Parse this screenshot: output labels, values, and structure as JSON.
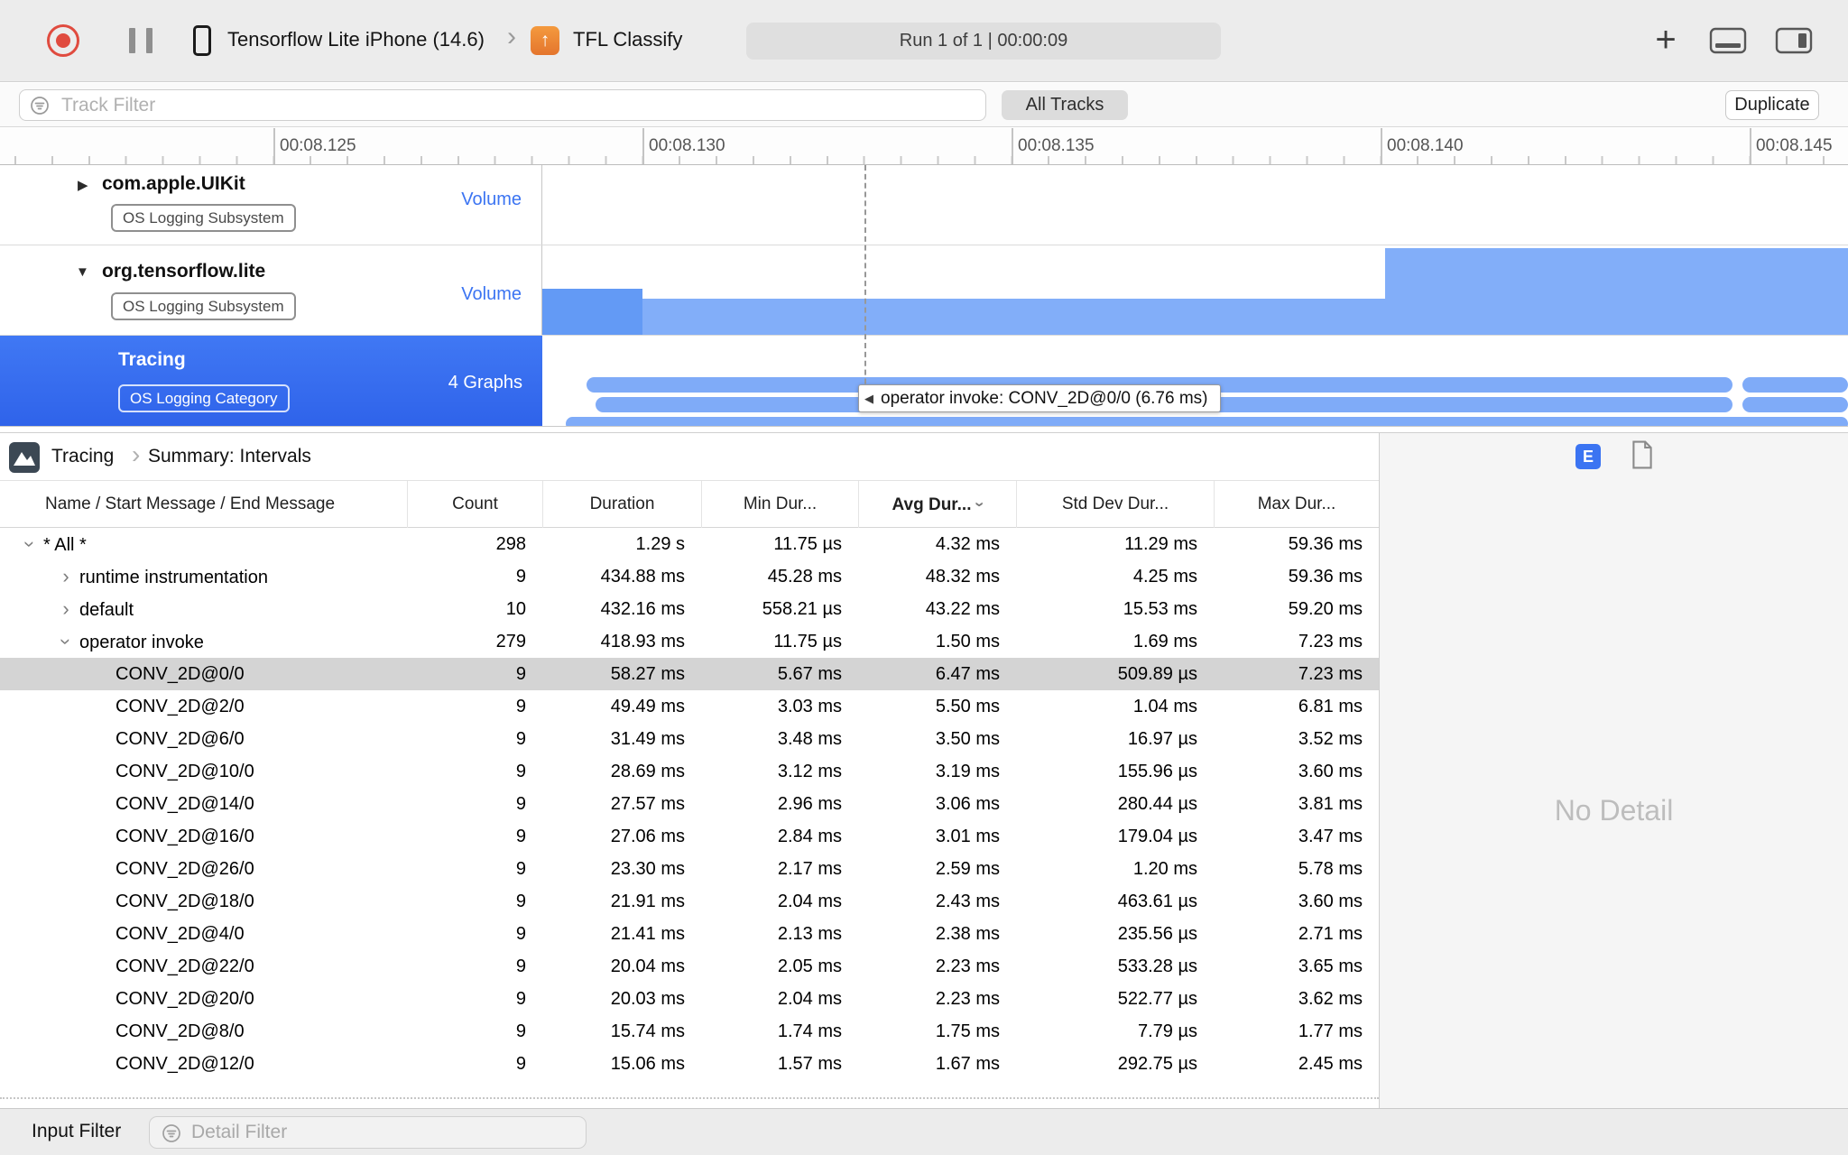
{
  "toolbar": {
    "device_name": "Tensorflow Lite iPhone (14.6)",
    "app_name": "TFL Classify",
    "run_status": "Run 1 of 1  |  00:00:09"
  },
  "filter_bar": {
    "track_filter_placeholder": "Track Filter",
    "all_tracks": "All Tracks",
    "duplicate": "Duplicate"
  },
  "ruler": {
    "labels": [
      "00:08.125",
      "00:08.130",
      "00:08.135",
      "00:08.140",
      "00:08.145"
    ]
  },
  "tracks": [
    {
      "name": "com.apple.UIKit",
      "badge": "OS Logging Subsystem",
      "meta": "Volume",
      "disclosure": "closed",
      "selected": false
    },
    {
      "name": "org.tensorflow.lite",
      "badge": "OS Logging Subsystem",
      "meta": "Volume",
      "disclosure": "open",
      "selected": false
    },
    {
      "name": "Tracing",
      "badge": "OS Logging Category",
      "meta": "4 Graphs",
      "disclosure": "none",
      "selected": true
    }
  ],
  "tooltip_text": "operator invoke: CONV_2D@0/0 (6.76 ms)",
  "detail": {
    "breadcrumb_root": "Tracing",
    "breadcrumb_page": "Summary: Intervals",
    "e_button": "E",
    "no_detail": "No Detail",
    "table": {
      "columns": [
        "Name / Start Message / End Message",
        "Count",
        "Duration",
        "Min Dur...",
        "Avg Dur...",
        "Std Dev Dur...",
        "Max Dur..."
      ],
      "sorted_column": "Avg Dur...",
      "rows": [
        {
          "indent": 0,
          "disclosure": "open",
          "name": "* All *",
          "count": "298",
          "duration": "1.29 s",
          "min": "11.75 µs",
          "avg": "4.32 ms",
          "std": "11.29 ms",
          "max": "59.36 ms",
          "selected": false
        },
        {
          "indent": 1,
          "disclosure": "closed",
          "name": "runtime instrumentation",
          "count": "9",
          "duration": "434.88 ms",
          "min": "45.28 ms",
          "avg": "48.32 ms",
          "std": "4.25 ms",
          "max": "59.36 ms",
          "selected": false
        },
        {
          "indent": 1,
          "disclosure": "closed",
          "name": "default",
          "count": "10",
          "duration": "432.16 ms",
          "min": "558.21 µs",
          "avg": "43.22 ms",
          "std": "15.53 ms",
          "max": "59.20 ms",
          "selected": false
        },
        {
          "indent": 1,
          "disclosure": "open",
          "name": "operator invoke",
          "count": "279",
          "duration": "418.93 ms",
          "min": "11.75 µs",
          "avg": "1.50 ms",
          "std": "1.69 ms",
          "max": "7.23 ms",
          "selected": false
        },
        {
          "indent": 2,
          "disclosure": null,
          "name": "CONV_2D@0/0",
          "count": "9",
          "duration": "58.27 ms",
          "min": "5.67 ms",
          "avg": "6.47 ms",
          "std": "509.89 µs",
          "max": "7.23 ms",
          "selected": true
        },
        {
          "indent": 2,
          "disclosure": null,
          "name": "CONV_2D@2/0",
          "count": "9",
          "duration": "49.49 ms",
          "min": "3.03 ms",
          "avg": "5.50 ms",
          "std": "1.04 ms",
          "max": "6.81 ms",
          "selected": false
        },
        {
          "indent": 2,
          "disclosure": null,
          "name": "CONV_2D@6/0",
          "count": "9",
          "duration": "31.49 ms",
          "min": "3.48 ms",
          "avg": "3.50 ms",
          "std": "16.97 µs",
          "max": "3.52 ms",
          "selected": false
        },
        {
          "indent": 2,
          "disclosure": null,
          "name": "CONV_2D@10/0",
          "count": "9",
          "duration": "28.69 ms",
          "min": "3.12 ms",
          "avg": "3.19 ms",
          "std": "155.96 µs",
          "max": "3.60 ms",
          "selected": false
        },
        {
          "indent": 2,
          "disclosure": null,
          "name": "CONV_2D@14/0",
          "count": "9",
          "duration": "27.57 ms",
          "min": "2.96 ms",
          "avg": "3.06 ms",
          "std": "280.44 µs",
          "max": "3.81 ms",
          "selected": false
        },
        {
          "indent": 2,
          "disclosure": null,
          "name": "CONV_2D@16/0",
          "count": "9",
          "duration": "27.06 ms",
          "min": "2.84 ms",
          "avg": "3.01 ms",
          "std": "179.04 µs",
          "max": "3.47 ms",
          "selected": false
        },
        {
          "indent": 2,
          "disclosure": null,
          "name": "CONV_2D@26/0",
          "count": "9",
          "duration": "23.30 ms",
          "min": "2.17 ms",
          "avg": "2.59 ms",
          "std": "1.20 ms",
          "max": "5.78 ms",
          "selected": false
        },
        {
          "indent": 2,
          "disclosure": null,
          "name": "CONV_2D@18/0",
          "count": "9",
          "duration": "21.91 ms",
          "min": "2.04 ms",
          "avg": "2.43 ms",
          "std": "463.61 µs",
          "max": "3.60 ms",
          "selected": false
        },
        {
          "indent": 2,
          "disclosure": null,
          "name": "CONV_2D@4/0",
          "count": "9",
          "duration": "21.41 ms",
          "min": "2.13 ms",
          "avg": "2.38 ms",
          "std": "235.56 µs",
          "max": "2.71 ms",
          "selected": false
        },
        {
          "indent": 2,
          "disclosure": null,
          "name": "CONV_2D@22/0",
          "count": "9",
          "duration": "20.04 ms",
          "min": "2.05 ms",
          "avg": "2.23 ms",
          "std": "533.28 µs",
          "max": "3.65 ms",
          "selected": false
        },
        {
          "indent": 2,
          "disclosure": null,
          "name": "CONV_2D@20/0",
          "count": "9",
          "duration": "20.03 ms",
          "min": "2.04 ms",
          "avg": "2.23 ms",
          "std": "522.77 µs",
          "max": "3.62 ms",
          "selected": false
        },
        {
          "indent": 2,
          "disclosure": null,
          "name": "CONV_2D@8/0",
          "count": "9",
          "duration": "15.74 ms",
          "min": "1.74 ms",
          "avg": "1.75 ms",
          "std": "7.79 µs",
          "max": "1.77 ms",
          "selected": false
        },
        {
          "indent": 2,
          "disclosure": null,
          "name": "CONV_2D@12/0",
          "count": "9",
          "duration": "15.06 ms",
          "min": "1.57 ms",
          "avg": "1.67 ms",
          "std": "292.75 µs",
          "max": "2.45 ms",
          "selected": false
        }
      ]
    }
  },
  "bottom_bar": {
    "input_filter": "Input Filter",
    "detail_filter_placeholder": "Detail Filter"
  },
  "icons": {
    "disclosure_open": "▼",
    "disclosure_closed": "▶",
    "chevron_right": "›",
    "plus": "+",
    "arrow_up": "↑",
    "tooltip_arrow": "◀"
  },
  "colors": {
    "accent_blue": "#3b74f2",
    "selection_blue": "#386df0",
    "capsule_blue": "#7fabf8",
    "volume_blue": "#82aef9",
    "volume_blue_dark": "#639af5",
    "record_red": "#e04b3f",
    "app_icon_orange": "#ef8939",
    "selected_row_gray": "#d4d4d4"
  }
}
